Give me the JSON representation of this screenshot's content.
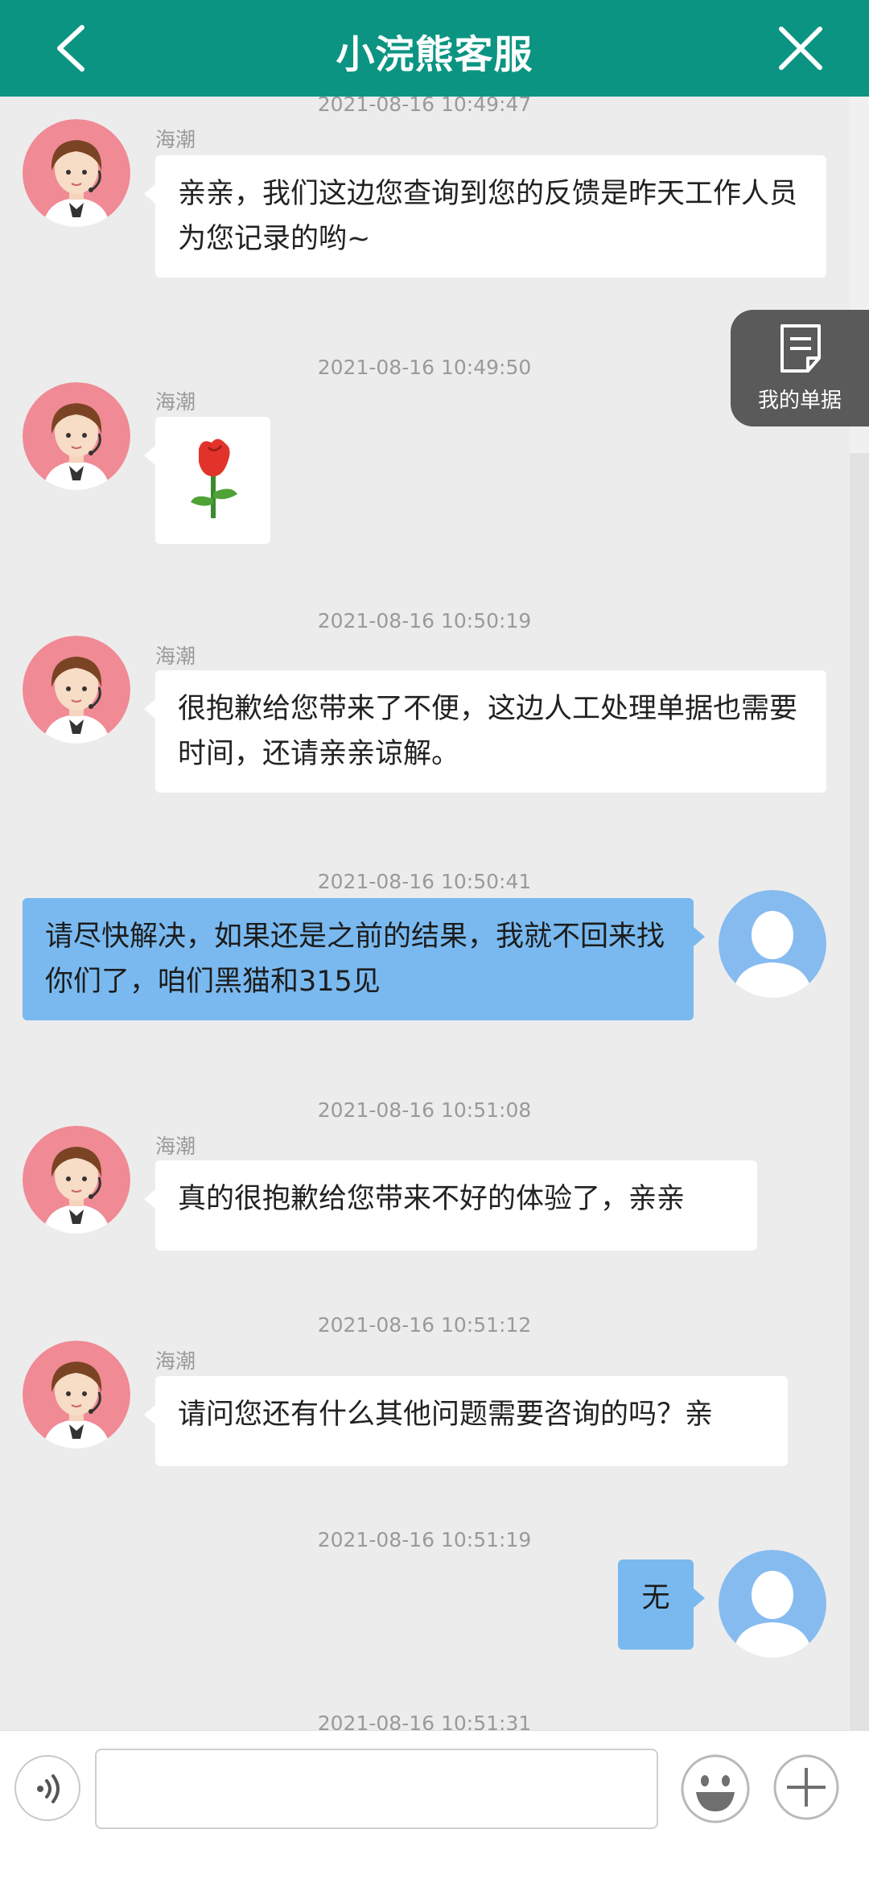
{
  "header": {
    "title": "小浣熊客服"
  },
  "floating": {
    "label": "我的单据"
  },
  "messages": [
    {
      "time": "2021-08-16 10:49:47",
      "sender": "海潮",
      "text": "亲亲，我们这边您查询到您的反馈是昨天工作人员为您记录的哟~"
    },
    {
      "time": "2021-08-16 10:49:50",
      "sender": "海潮",
      "image": "rose-icon"
    },
    {
      "time": "2021-08-16 10:50:19",
      "sender": "海潮",
      "text": "很抱歉给您带来了不便，这边人工处理单据也需要时间，还请亲亲谅解。"
    },
    {
      "time": "2021-08-16 10:50:41",
      "text": "请尽快解决，如果还是之前的结果，我就不回来找你们了，咱们黑猫和315见"
    },
    {
      "time": "2021-08-16 10:51:08",
      "sender": "海潮",
      "text": "真的很抱歉给您带来不好的体验了，亲亲"
    },
    {
      "time": "2021-08-16 10:51:12",
      "sender": "海潮",
      "text": "请问您还有什么其他问题需要咨询的吗？亲"
    },
    {
      "time": "2021-08-16 10:51:19",
      "text": "无"
    },
    {
      "time": "2021-08-16 10:51:31"
    }
  ],
  "input": {
    "value": ""
  },
  "colors": {
    "header": "#0c9482",
    "user_bubble": "#79b9ef",
    "agent_bubble": "#ffffff",
    "background": "#ececec"
  }
}
